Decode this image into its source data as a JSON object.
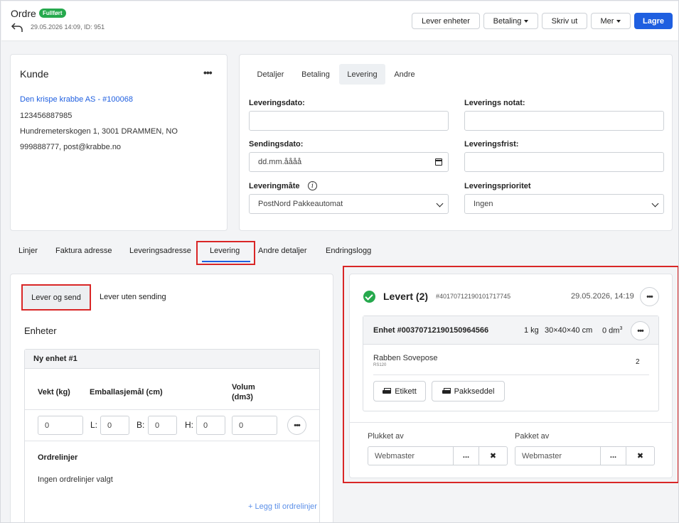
{
  "header": {
    "title": "Ordre",
    "status_badge": "Fullført",
    "subtitle": "29.05.2026 14:09, ID: 951",
    "buttons": {
      "lever_enheter": "Lever enheter",
      "betaling": "Betaling",
      "skriv_ut": "Skriv ut",
      "mer": "Mer",
      "lagre": "Lagre"
    }
  },
  "kunde": {
    "title": "Kunde",
    "customer_link": "Den krispe krabbe AS - #100068",
    "org_number": "123456887985",
    "address": "Hundremeterskogen 1, 3001 DRAMMEN, NO",
    "contact": "999888777, post@krabbe.no"
  },
  "details_tabs": [
    "Detaljer",
    "Betaling",
    "Levering",
    "Andre"
  ],
  "delivery_form": {
    "leveringsdato_label": "Leveringsdato:",
    "leveringsdato_value": "",
    "leverings_notat_label": "Leverings notat:",
    "leverings_notat_value": "",
    "sendingsdato_label": "Sendingsdato:",
    "sendingsdato_placeholder": "dd.mm.åååå",
    "leveringsfrist_label": "Leveringsfrist:",
    "leveringsfrist_value": "",
    "leveringsmate_label": "Leveringmåte",
    "leveringsmate_value": "PostNord Pakkeautomat",
    "leveringsprioritet_label": "Leveringsprioritet",
    "leveringsprioritet_value": "Ingen"
  },
  "order_tabs": [
    "Linjer",
    "Faktura adresse",
    "Leveringsadresse",
    "Levering",
    "Andre detaljer",
    "Endringslogg"
  ],
  "active_order_tab": "Levering",
  "delivery_subtabs": {
    "active": "Lever og send",
    "other": "Lever uten sending"
  },
  "units": {
    "title": "Enheter",
    "new_unit_title": "Ny enhet #1",
    "col_weight": "Vekt (kg)",
    "col_dimensions": "Emballasjemål (cm)",
    "col_volume_line1": "Volum",
    "col_volume_line2": "(dm3)",
    "weight_value": "0",
    "length_label": "L:",
    "length_value": "0",
    "width_label": "B:",
    "width_value": "0",
    "height_label": "H:",
    "height_value": "0",
    "volume_value": "0",
    "order_lines_title": "Ordrelinjer",
    "no_order_lines": "Ingen ordrelinjer valgt",
    "add_order_lines": "Legg til ordrelinjer"
  },
  "delivered": {
    "title": "Levert (2)",
    "tracking": "#40170712190101717745",
    "date": "29.05.2026, 14:19",
    "unit": {
      "title": "Enhet #00370712190150964566",
      "weight": "1 kg",
      "dimensions": "30×40×40 cm",
      "volume_text": "0 dm",
      "volume_sup": "3",
      "product_name": "Rabben Sovepose",
      "product_sku": "RS120",
      "quantity": "2",
      "etikett": "Etikett",
      "pakkseddel": "Pakkseddel"
    },
    "plukket_av_label": "Plukket av",
    "plukket_av_value": "Webmaster",
    "pakket_av_label": "Pakket av",
    "pakket_av_value": "Webmaster",
    "dots": "...",
    "clear": "✖"
  },
  "icons": {
    "more_dots": "•••",
    "info": "i"
  },
  "colors": {
    "primary": "#1f5fe0",
    "success": "#26a94d",
    "highlight": "#d92626"
  }
}
